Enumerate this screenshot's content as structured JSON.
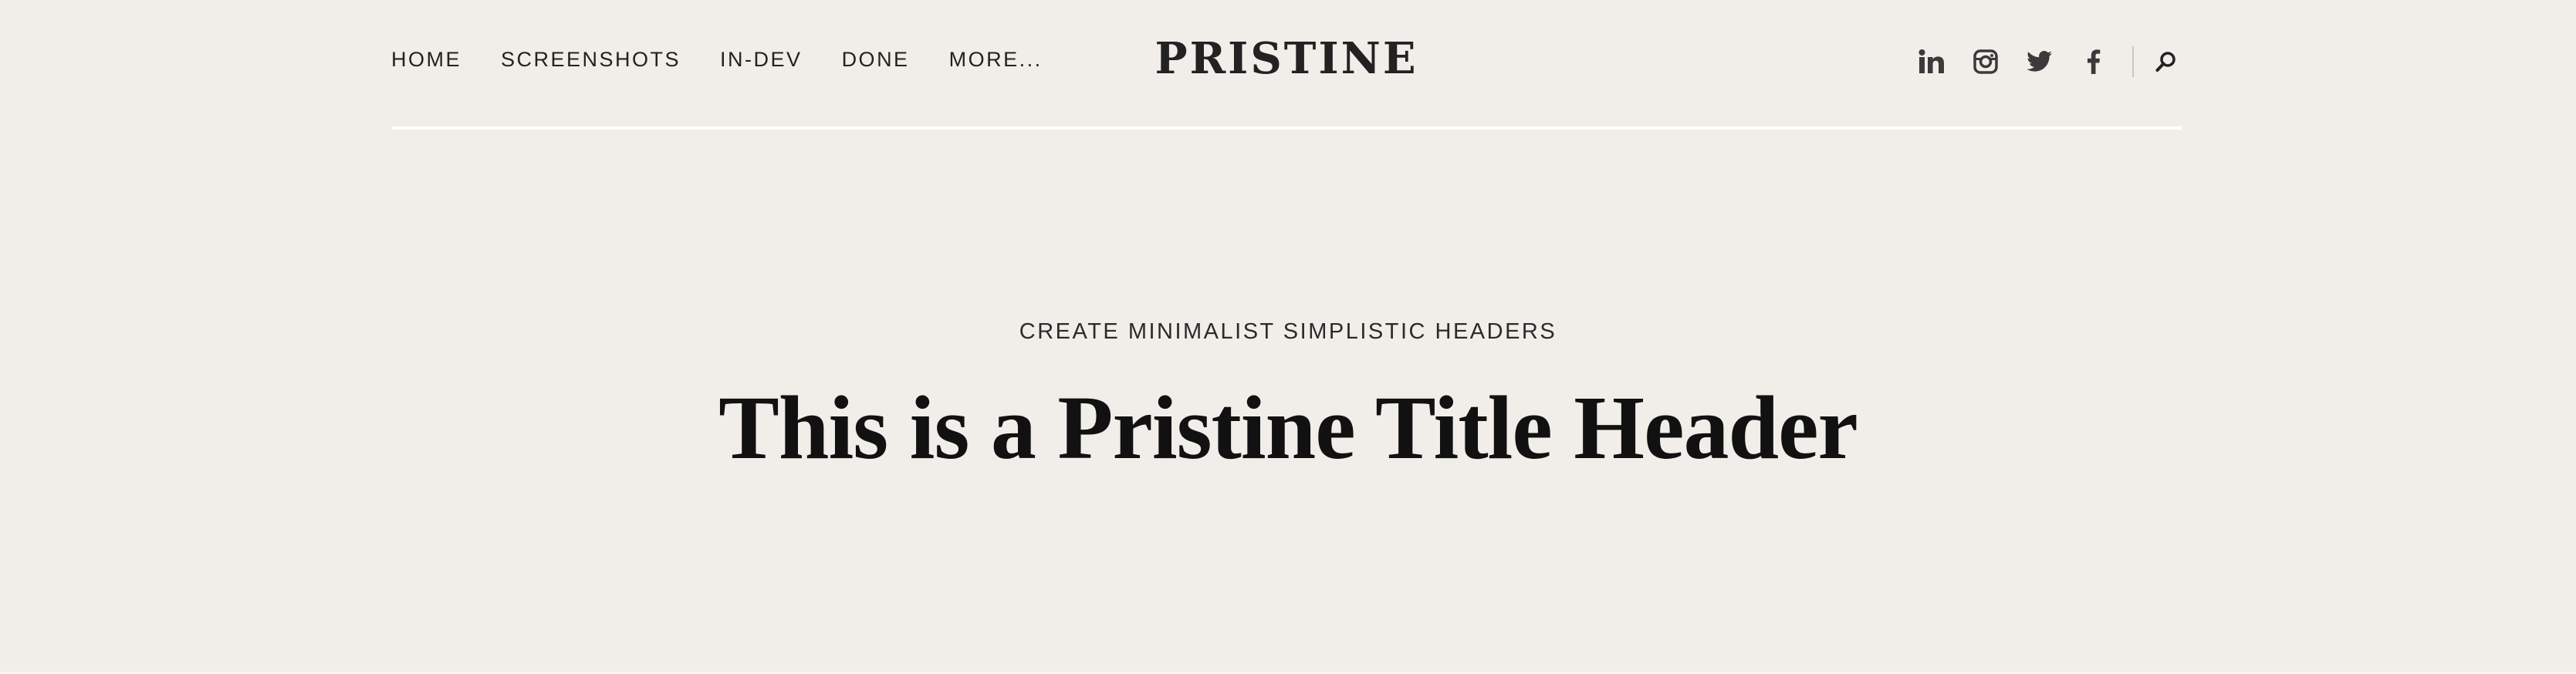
{
  "nav": {
    "items": [
      {
        "label": "HOME"
      },
      {
        "label": "SCREENSHOTS"
      },
      {
        "label": "IN-DEV"
      },
      {
        "label": "DONE"
      },
      {
        "label": "MORE..."
      }
    ]
  },
  "brand": {
    "logo_text": "PRISTINE"
  },
  "social": {
    "icons": [
      "linkedin-icon",
      "instagram-icon",
      "twitter-icon",
      "facebook-icon",
      "search-icon"
    ]
  },
  "hero": {
    "kicker": "CREATE MINIMALIST SIMPLISTIC HEADERS",
    "title": "This is a Pristine Title Header"
  },
  "colors": {
    "background": "#f1eee9",
    "text": "#222222",
    "rule": "#ffffff"
  }
}
